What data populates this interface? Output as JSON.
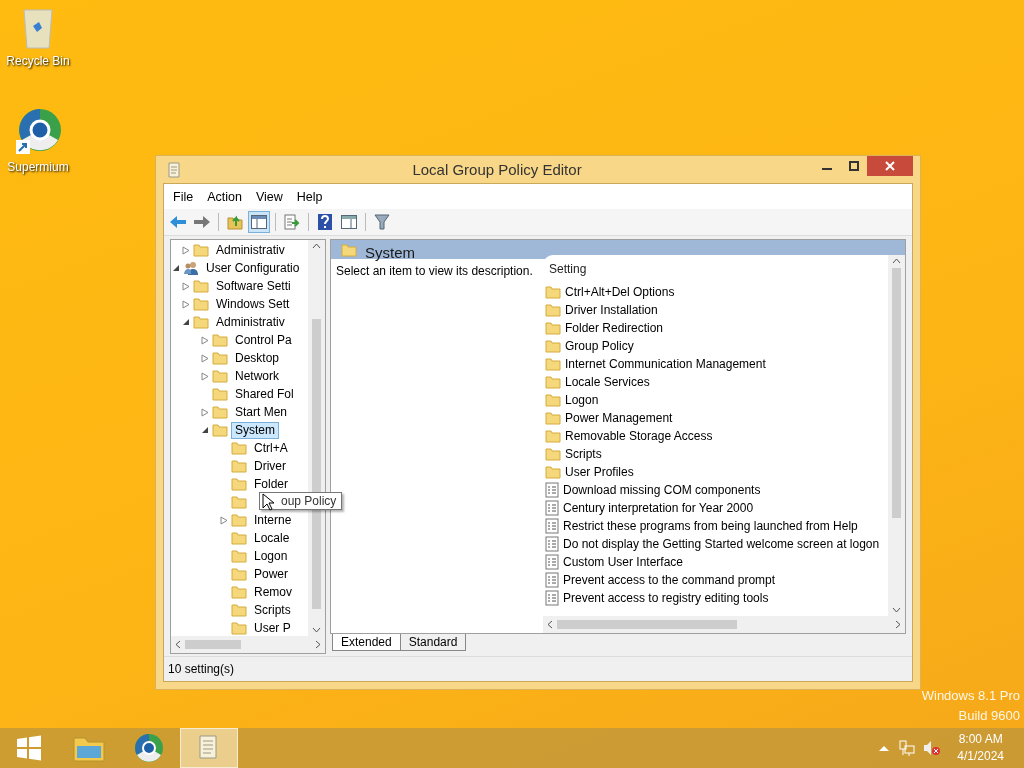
{
  "desktop_icons": [
    {
      "kind": "bin",
      "label": "Recycle Bin"
    },
    {
      "kind": "browser",
      "label": "Supermium"
    }
  ],
  "window": {
    "title": "Local Group Policy Editor"
  },
  "menu": [
    "File",
    "Action",
    "View",
    "Help"
  ],
  "toolbar": [
    {
      "kind": "back",
      "pressed": false
    },
    {
      "kind": "forward",
      "pressed": false
    },
    {
      "kind": "sep"
    },
    {
      "kind": "up",
      "pressed": false
    },
    {
      "kind": "tree",
      "pressed": true
    },
    {
      "kind": "sep"
    },
    {
      "kind": "export",
      "pressed": false
    },
    {
      "kind": "sep"
    },
    {
      "kind": "help",
      "pressed": false
    },
    {
      "kind": "view",
      "pressed": false
    },
    {
      "kind": "sep"
    },
    {
      "kind": "filter",
      "pressed": false
    }
  ],
  "tree": [
    {
      "children": [
        {
          "kind": "folder",
          "label": "Administrativ",
          "expanded": false
        }
      ]
    },
    {
      "kind": "user",
      "label": "User Configuratio",
      "expanded": true,
      "children": [
        {
          "kind": "folder",
          "label": "Software Setti",
          "expanded": false
        },
        {
          "kind": "folder",
          "label": "Windows Sett",
          "expanded": false
        },
        {
          "kind": "folder",
          "label": "Administrativ",
          "expanded": true,
          "children": [
            {
              "kind": "folder",
              "label": "Control Pa",
              "expanded": false
            },
            {
              "kind": "folder",
              "label": "Desktop",
              "expanded": false
            },
            {
              "kind": "folder",
              "label": "Network",
              "expanded": false
            },
            {
              "kind": "folder",
              "label": "Shared Fol"
            },
            {
              "kind": "folder",
              "label": "Start Men",
              "expanded": false
            },
            {
              "kind": "folder",
              "label": "System",
              "expanded": true,
              "selected": true,
              "children": [
                {
                  "kind": "folder",
                  "label": "Ctrl+A"
                },
                {
                  "kind": "folder",
                  "label": "Driver"
                },
                {
                  "kind": "folder",
                  "label": "Folder"
                },
                {
                  "kind": "folder"
                },
                {
                  "kind": "folder",
                  "label": "Interne",
                  "expanded": false
                },
                {
                  "kind": "folder",
                  "label": "Locale"
                },
                {
                  "kind": "folder",
                  "label": "Logon"
                },
                {
                  "kind": "folder",
                  "label": "Power"
                },
                {
                  "kind": "folder",
                  "label": "Remov"
                },
                {
                  "kind": "folder",
                  "label": "Scripts"
                },
                {
                  "kind": "folder",
                  "label": "User P"
                }
              ]
            }
          ]
        }
      ]
    }
  ],
  "tooltip": "oup Policy",
  "pane": {
    "title": "System",
    "description": "Select an item to view its description.",
    "column": "Setting"
  },
  "settings": [
    {
      "kind": "folder",
      "label": "Ctrl+Alt+Del Options"
    },
    {
      "kind": "folder",
      "label": "Driver Installation"
    },
    {
      "kind": "folder",
      "label": "Folder Redirection"
    },
    {
      "kind": "folder",
      "label": "Group Policy"
    },
    {
      "kind": "folder",
      "label": "Internet Communication Management"
    },
    {
      "kind": "folder",
      "label": "Locale Services"
    },
    {
      "kind": "folder",
      "label": "Logon"
    },
    {
      "kind": "folder",
      "label": "Power Management"
    },
    {
      "kind": "folder",
      "label": "Removable Storage Access"
    },
    {
      "kind": "folder",
      "label": "Scripts"
    },
    {
      "kind": "folder",
      "label": "User Profiles"
    },
    {
      "kind": "policy",
      "label": "Download missing COM components"
    },
    {
      "kind": "policy",
      "label": "Century interpretation for Year 2000"
    },
    {
      "kind": "policy",
      "label": "Restrict these programs from being launched from Help"
    },
    {
      "kind": "policy",
      "label": "Do not display the Getting Started welcome screen at logon"
    },
    {
      "kind": "policy",
      "label": "Custom User Interface"
    },
    {
      "kind": "policy",
      "label": "Prevent access to the command prompt"
    },
    {
      "kind": "policy",
      "label": "Prevent access to registry editing tools"
    }
  ],
  "tabs": [
    {
      "label": "Extended",
      "selected": true
    },
    {
      "label": "Standard",
      "selected": false
    }
  ],
  "status_bar": "10 setting(s)",
  "os_watermark": [
    "Windows 8.1 Pro",
    "Build 9600"
  ],
  "taskbar": [
    {
      "kind": "explorer",
      "active": false
    },
    {
      "kind": "browser",
      "active": false
    },
    {
      "kind": "gpedit",
      "active": true
    }
  ],
  "clock": {
    "time": "8:00 AM",
    "date": "4/1/2024"
  }
}
